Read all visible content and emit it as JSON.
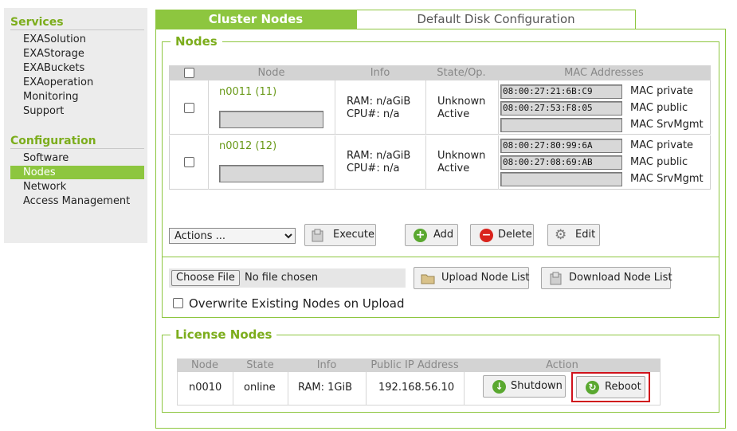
{
  "sidebar": {
    "services_heading": "Services",
    "services": [
      "EXASolution",
      "EXAStorage",
      "EXABuckets",
      "EXAoperation",
      "Monitoring",
      "Support"
    ],
    "configuration_heading": "Configuration",
    "configuration": [
      "Software",
      "Nodes",
      "Network",
      "Access Management"
    ],
    "active_item": "Nodes"
  },
  "tabs": {
    "cluster_nodes": "Cluster Nodes",
    "default_disk": "Default Disk Configuration",
    "active": "Cluster Nodes"
  },
  "nodes_section": {
    "legend": "Nodes",
    "columns": {
      "node": "Node",
      "info": "Info",
      "state": "State/Op.",
      "mac": "MAC Addresses"
    },
    "rows": [
      {
        "name": "n0011 (11)",
        "ram": "RAM: n/aGiB",
        "cpu": "CPU#: n/a",
        "state": "Unknown",
        "op": "Active",
        "mac_private": "08:00:27:21:6B:C9",
        "mac_public": "08:00:27:53:F8:05",
        "mac_srvmgmt": "",
        "label_private": "MAC private",
        "label_public": "MAC public",
        "label_srvmgmt": "MAC SrvMgmt"
      },
      {
        "name": "n0012 (12)",
        "ram": "RAM: n/aGiB",
        "cpu": "CPU#: n/a",
        "state": "Unknown",
        "op": "Active",
        "mac_private": "08:00:27:80:99:6A",
        "mac_public": "08:00:27:08:69:AB",
        "mac_srvmgmt": "",
        "label_private": "MAC private",
        "label_public": "MAC public",
        "label_srvmgmt": "MAC SrvMgmt"
      }
    ],
    "actions_select": "Actions ...",
    "buttons": {
      "execute": "Execute",
      "add": "Add",
      "delete": "Delete",
      "edit": "Edit"
    },
    "choose_file": "Choose File",
    "no_file": "No file chosen",
    "upload": "Upload Node List",
    "download": "Download Node List",
    "overwrite_label": "Overwrite Existing Nodes on Upload"
  },
  "license_section": {
    "legend": "License Nodes",
    "columns": {
      "node": "Node",
      "state": "State",
      "info": "Info",
      "ip": "Public IP Address",
      "action": "Action"
    },
    "row": {
      "node": "n0010",
      "state": "online",
      "info": "RAM: 1GiB",
      "ip": "192.168.56.10"
    },
    "buttons": {
      "shutdown": "Shutdown",
      "reboot": "Reboot"
    },
    "highlight_color": "#d0121b"
  }
}
